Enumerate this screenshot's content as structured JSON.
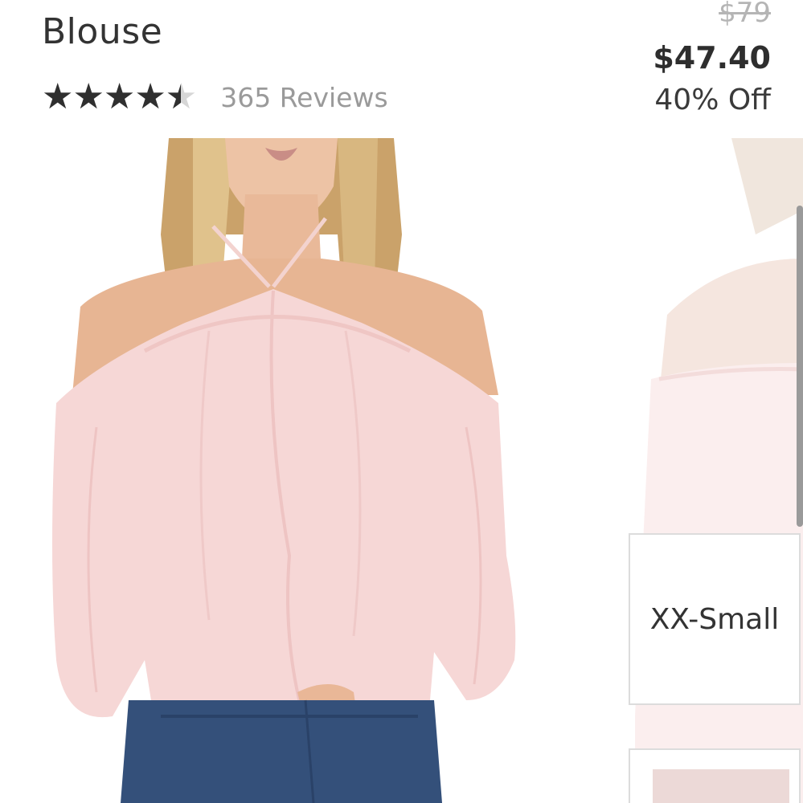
{
  "product": {
    "title": "Blouse",
    "rating": 4.5,
    "stars_glyphs": "★★★★★",
    "reviews_label": "365 Reviews"
  },
  "pricing": {
    "original": "$79",
    "sale": "$47.40",
    "discount": "40% Off"
  },
  "sizes": [
    {
      "label": "XX-Small"
    },
    {
      "label": ""
    }
  ],
  "colors": {
    "blouse": "#f6d7d6",
    "skin": "#e7b593",
    "hair": "#caa26a",
    "denim": "#34507a"
  }
}
